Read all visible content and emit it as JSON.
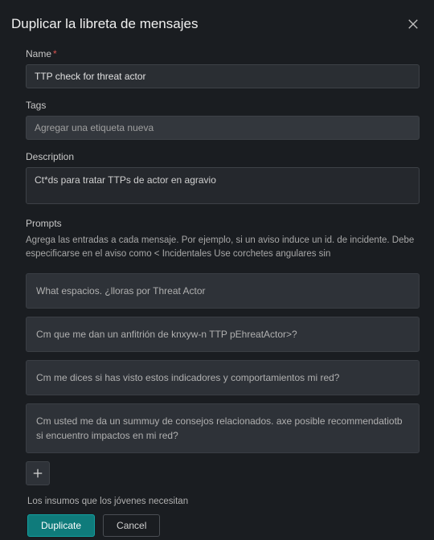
{
  "dialog": {
    "title": "Duplicar la libreta de mensajes"
  },
  "name": {
    "label": "Name",
    "value": "TTP check for threat actor"
  },
  "tags": {
    "label": "Tags",
    "placeholder": "Agregar una etiqueta nueva"
  },
  "description": {
    "label": "Description",
    "value": "Ct*ds para tratar TTPs de actor en agravio"
  },
  "prompts": {
    "label": "Prompts",
    "help": "Agrega las entradas a cada mensaje. Por ejemplo, si un aviso induce un id. de incidente. Debe especificarse en el aviso como < Incidentales Use corchetes angulares sin",
    "items": [
      "What espacios. ¿lloras por Threat Actor",
      "Cm que me dan un anfitrión de knxyw-n TTP pEhreatActor>?",
      "Cm me dices si has visto estos indicadores y comportamientos mi red?",
      "Cm usted me da un summuy de consejos relacionados. axe posible recommendatiotb si encuentro impactos en mi red?"
    ]
  },
  "footer": {
    "note": "Los insumos que los jóvenes necesitan",
    "duplicate": "Duplicate",
    "cancel": "Cancel"
  }
}
